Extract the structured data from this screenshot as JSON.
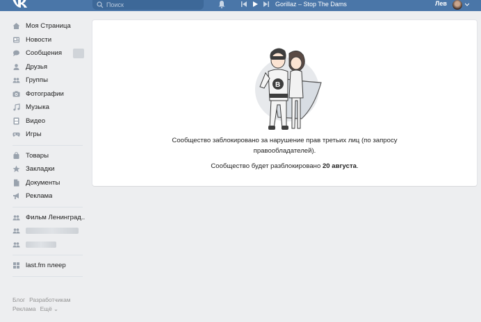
{
  "topbar": {
    "search_placeholder": "Поиск",
    "track": "Gorillaz – Stop The Dams",
    "user_name": "Лев"
  },
  "sidebar": {
    "main": [
      {
        "label": "Моя Страница",
        "icon": "home-icon"
      },
      {
        "label": "Новости",
        "icon": "news-icon"
      },
      {
        "label": "Сообщения",
        "icon": "messages-icon"
      },
      {
        "label": "Друзья",
        "icon": "friends-icon"
      },
      {
        "label": "Группы",
        "icon": "groups-icon"
      },
      {
        "label": "Фотографии",
        "icon": "camera-icon"
      },
      {
        "label": "Музыка",
        "icon": "music-icon"
      },
      {
        "label": "Видео",
        "icon": "video-icon"
      },
      {
        "label": "Игры",
        "icon": "gamepad-icon"
      }
    ],
    "secondary": [
      {
        "label": "Товары",
        "icon": "bag-icon"
      },
      {
        "label": "Закладки",
        "icon": "star-icon"
      },
      {
        "label": "Документы",
        "icon": "document-icon"
      },
      {
        "label": "Реклама",
        "icon": "megaphone-icon"
      }
    ],
    "communities": [
      {
        "label": "Фильм Ленинград..",
        "icon": "community-icon"
      }
    ],
    "apps": [
      {
        "label": "last.fm плеер",
        "icon": "apps-grid-icon"
      }
    ],
    "footer": [
      "Блог",
      "Разработчикам",
      "Реклама",
      "Ещё ⌄"
    ]
  },
  "main": {
    "message_line1": "Сообщество заблокировано за нарушение прав третьих лиц (по запросу правообладателей).",
    "message_line2_prefix": "Сообщество будет разблокировано ",
    "unblock_date": "20 августа",
    "message_line2_suffix": "."
  },
  "colors": {
    "header": "#4a76a8",
    "background": "#edeef0",
    "icon": "#99a2ad",
    "text": "#222222"
  }
}
